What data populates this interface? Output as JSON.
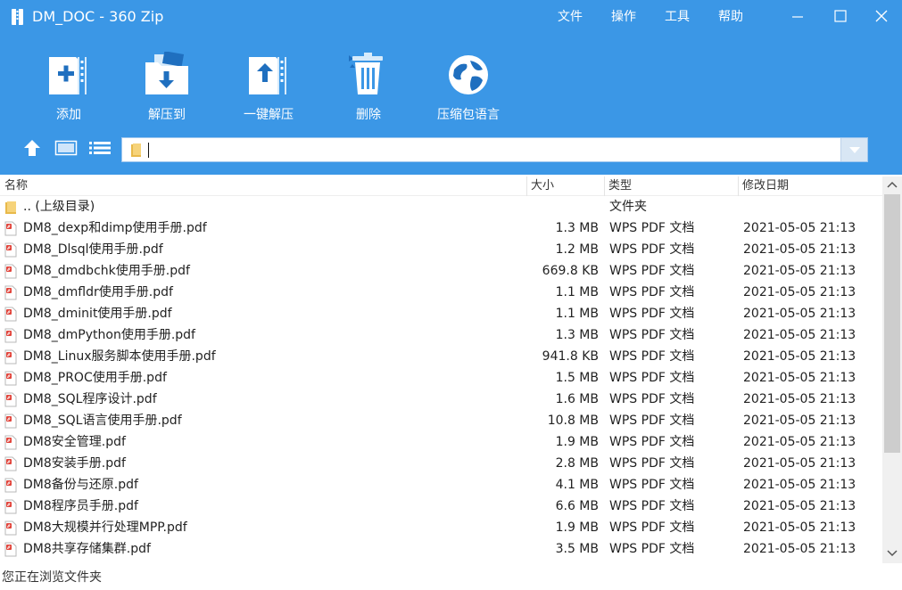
{
  "window": {
    "title": "DM_DOC - 360 Zip",
    "menu": [
      "文件",
      "操作",
      "工具",
      "帮助"
    ],
    "accent_color": "#3b97e6"
  },
  "toolbar": {
    "add_label": "添加",
    "extract_to_label": "解压到",
    "one_click_extract_label": "一键解压",
    "delete_label": "删除",
    "archive_language_label": "压缩包语言"
  },
  "path_bar": {
    "value": ""
  },
  "list": {
    "columns": {
      "name": "名称",
      "size": "大小",
      "type": "类型",
      "modified": "修改日期"
    },
    "rows": [
      {
        "name": ".. (上级目录)",
        "size": "",
        "type": "文件夹",
        "modified": "",
        "icon": "folder-icon"
      },
      {
        "name": "DM8_dexp和dimp使用手册.pdf",
        "size": "1.3 MB",
        "type": "WPS PDF 文档",
        "modified": "2021-05-05 21:13",
        "icon": "pdf-file-icon"
      },
      {
        "name": "DM8_Dlsql使用手册.pdf",
        "size": "1.2 MB",
        "type": "WPS PDF 文档",
        "modified": "2021-05-05 21:13",
        "icon": "pdf-file-icon"
      },
      {
        "name": "DM8_dmdbchk使用手册.pdf",
        "size": "669.8 KB",
        "type": "WPS PDF 文档",
        "modified": "2021-05-05 21:13",
        "icon": "pdf-file-icon"
      },
      {
        "name": "DM8_dmfldr使用手册.pdf",
        "size": "1.1 MB",
        "type": "WPS PDF 文档",
        "modified": "2021-05-05 21:13",
        "icon": "pdf-file-icon"
      },
      {
        "name": "DM8_dminit使用手册.pdf",
        "size": "1.1 MB",
        "type": "WPS PDF 文档",
        "modified": "2021-05-05 21:13",
        "icon": "pdf-file-icon"
      },
      {
        "name": "DM8_dmPython使用手册.pdf",
        "size": "1.3 MB",
        "type": "WPS PDF 文档",
        "modified": "2021-05-05 21:13",
        "icon": "pdf-file-icon"
      },
      {
        "name": "DM8_Linux服务脚本使用手册.pdf",
        "size": "941.8 KB",
        "type": "WPS PDF 文档",
        "modified": "2021-05-05 21:13",
        "icon": "pdf-file-icon"
      },
      {
        "name": "DM8_PROC使用手册.pdf",
        "size": "1.5 MB",
        "type": "WPS PDF 文档",
        "modified": "2021-05-05 21:13",
        "icon": "pdf-file-icon"
      },
      {
        "name": "DM8_SQL程序设计.pdf",
        "size": "1.6 MB",
        "type": "WPS PDF 文档",
        "modified": "2021-05-05 21:13",
        "icon": "pdf-file-icon"
      },
      {
        "name": "DM8_SQL语言使用手册.pdf",
        "size": "10.8 MB",
        "type": "WPS PDF 文档",
        "modified": "2021-05-05 21:13",
        "icon": "pdf-file-icon"
      },
      {
        "name": "DM8安全管理.pdf",
        "size": "1.9 MB",
        "type": "WPS PDF 文档",
        "modified": "2021-05-05 21:13",
        "icon": "pdf-file-icon"
      },
      {
        "name": "DM8安装手册.pdf",
        "size": "2.8 MB",
        "type": "WPS PDF 文档",
        "modified": "2021-05-05 21:13",
        "icon": "pdf-file-icon"
      },
      {
        "name": "DM8备份与还原.pdf",
        "size": "4.1 MB",
        "type": "WPS PDF 文档",
        "modified": "2021-05-05 21:13",
        "icon": "pdf-file-icon"
      },
      {
        "name": "DM8程序员手册.pdf",
        "size": "6.6 MB",
        "type": "WPS PDF 文档",
        "modified": "2021-05-05 21:13",
        "icon": "pdf-file-icon"
      },
      {
        "name": "DM8大规模并行处理MPP.pdf",
        "size": "1.9 MB",
        "type": "WPS PDF 文档",
        "modified": "2021-05-05 21:13",
        "icon": "pdf-file-icon"
      },
      {
        "name": "DM8共享存储集群.pdf",
        "size": "3.5 MB",
        "type": "WPS PDF 文档",
        "modified": "2021-05-05 21:13",
        "icon": "pdf-file-icon"
      }
    ]
  },
  "status": {
    "text": "您正在浏览文件夹"
  }
}
